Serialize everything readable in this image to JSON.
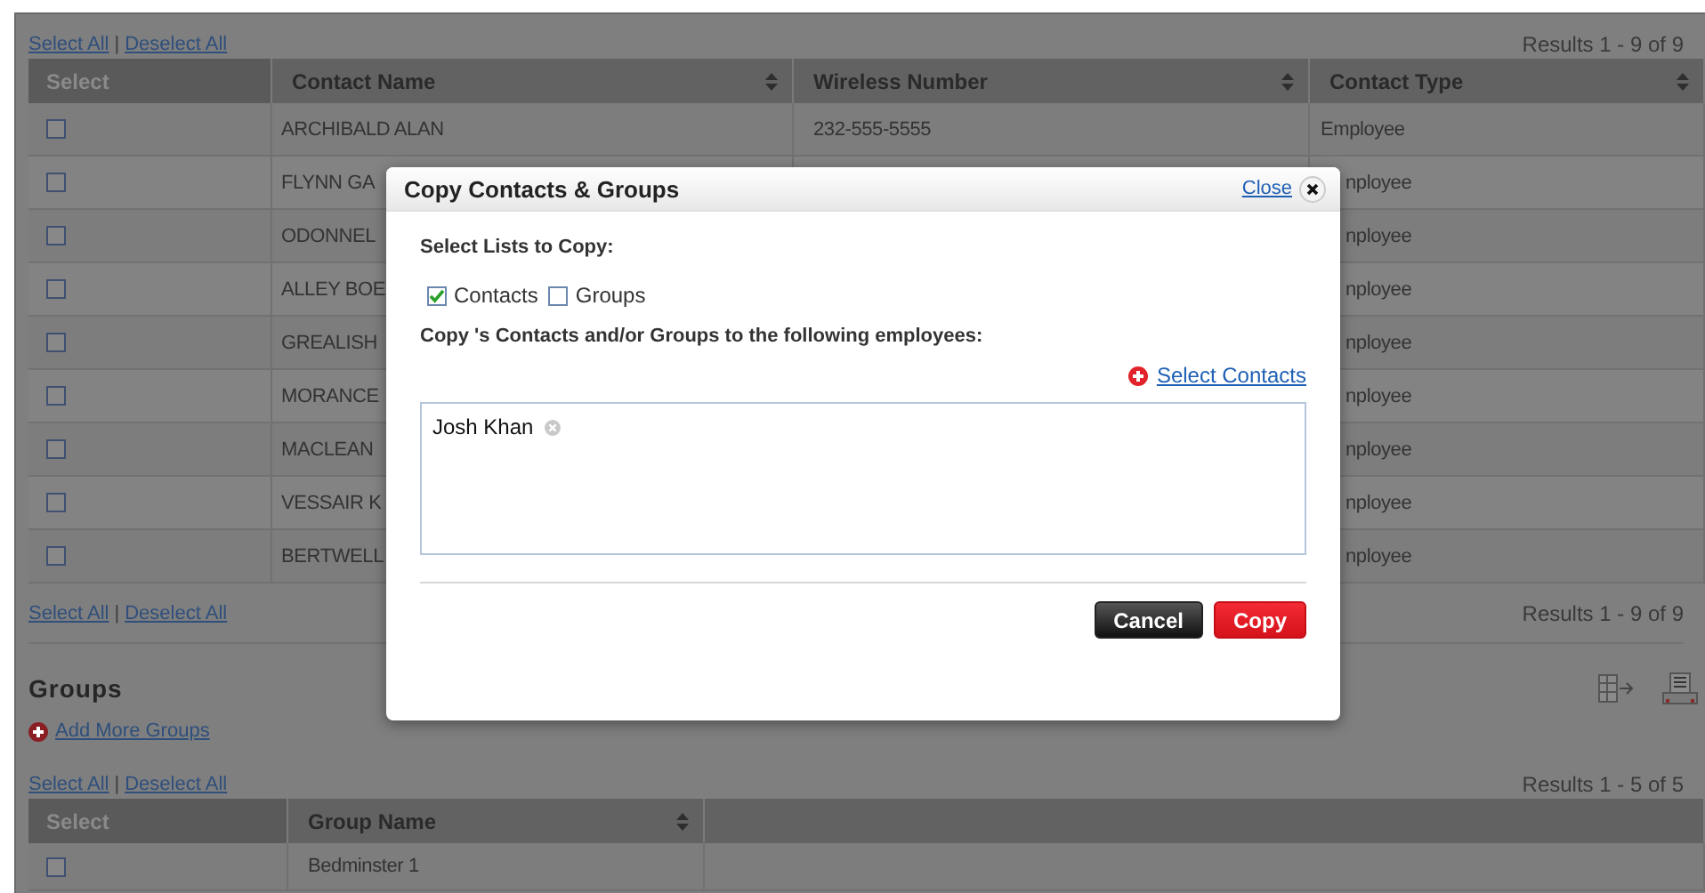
{
  "top_bar": {
    "links": [
      "Select All",
      "Deselect All"
    ],
    "separator": "|",
    "results": "Results 1 - 9 of 9"
  },
  "contacts_table": {
    "columns": [
      {
        "label": "Select",
        "sortable": false
      },
      {
        "label": "Contact Name",
        "sortable": true
      },
      {
        "label": "Wireless Number",
        "sortable": true
      },
      {
        "label": "Contact Type",
        "sortable": true
      }
    ],
    "rows": [
      {
        "checked": false,
        "name": "ARCHIBALD ALAN",
        "wireless": "232-555-5555",
        "type": "Employee"
      },
      {
        "checked": false,
        "name": "FLYNN GA",
        "type": "nployee"
      },
      {
        "checked": false,
        "name": "ODONNEL",
        "type": "nployee"
      },
      {
        "checked": false,
        "name": "ALLEY BOE",
        "type": "nployee"
      },
      {
        "checked": false,
        "name": "GREALISH",
        "type": "nployee"
      },
      {
        "checked": false,
        "name": "MORANCE",
        "type": "nployee"
      },
      {
        "checked": false,
        "name": "MACLEAN",
        "type": "nployee"
      },
      {
        "checked": false,
        "name": "VESSAIR K",
        "type": "nployee"
      },
      {
        "checked": false,
        "name": "BERTWELL",
        "type": "nployee"
      }
    ]
  },
  "bottom_bar": {
    "links": [
      "Select All",
      "Deselect All"
    ],
    "separator": "|",
    "results": "Results 1 - 9 of 9"
  },
  "groups": {
    "title": "Groups",
    "add_link": "Add More Groups",
    "links": [
      "Select All",
      "Deselect All"
    ],
    "separator": "|",
    "results": "Results 1 - 5 of 5",
    "columns": [
      {
        "label": "Select",
        "sortable": false
      },
      {
        "label": "Group Name",
        "sortable": true
      }
    ],
    "rows": [
      {
        "checked": false,
        "name": "Bedminster 1"
      }
    ]
  },
  "dialog": {
    "title": "Copy Contacts & Groups",
    "close": "Close",
    "section_label": "Select Lists to Copy:",
    "lists": [
      {
        "label": "Contacts",
        "checked": true
      },
      {
        "label": "Groups",
        "checked": false
      }
    ],
    "instruction": "Copy 's Contacts and/or Groups to the following employees:",
    "select_contacts": "Select Contacts",
    "recipients": [
      {
        "name": "Josh Khan"
      }
    ],
    "buttons": [
      {
        "label": "Cancel",
        "kind": "secondary"
      },
      {
        "label": "Copy",
        "kind": "primary"
      }
    ]
  }
}
